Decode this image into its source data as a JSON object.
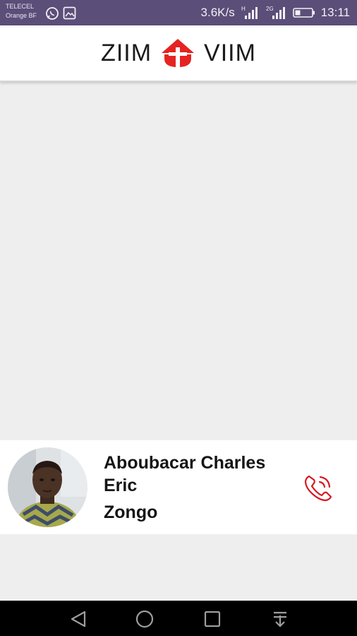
{
  "status_bar": {
    "carrier_1": "TELECEL",
    "carrier_2": "Orange BF",
    "speed": "3.6K/s",
    "signal_1_label": "H",
    "signal_2_label": "2G",
    "time": "13:11"
  },
  "header": {
    "logo_left": "ZIIM",
    "logo_right": "VIIM",
    "logo_color": "#e52421"
  },
  "contact": {
    "name_line_1": "Aboubacar Charles",
    "name_line_2": "Eric",
    "name_line_3": "Zongo",
    "call_icon": "phone-call-icon",
    "call_color": "#d71920"
  },
  "nav_bar": {
    "back": "back-icon",
    "home": "home-icon",
    "recents": "recents-icon",
    "notifications": "pull-down-icon"
  }
}
